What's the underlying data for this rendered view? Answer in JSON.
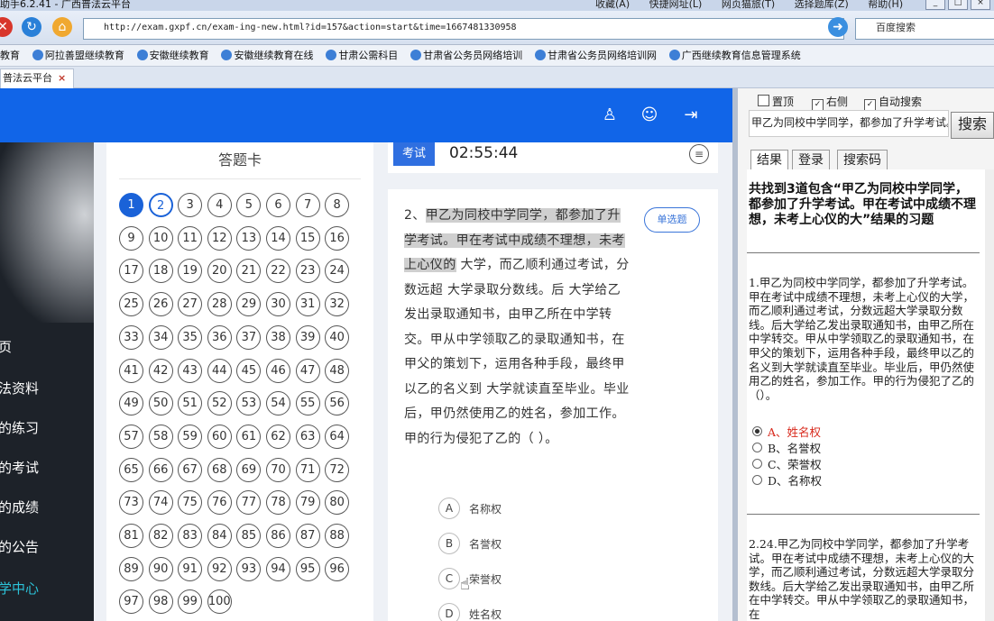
{
  "browser": {
    "title": "助手6.2.41  -  广西普法云平台",
    "menu": [
      "收藏(A)",
      "快捷网址(L)",
      "网页猫旅(T)",
      "选择题库(Z)",
      "帮助(H)"
    ],
    "url": "http://exam.gxpf.cn/exam-ing-new.html?id=157&action=start&time=1667481330958",
    "search_placeholder": "百度搜索",
    "favorites": [
      "教育",
      "阿拉善盟继续教育",
      "安徽继续教育",
      "安徽继续教育在线",
      "甘肃公需科目",
      "甘肃省公务员网络培训",
      "甘肃省公务员网络培训网",
      "广西继续教育信息管理系统"
    ],
    "tab_title": "普法云平台"
  },
  "sidebar": {
    "items": [
      "页",
      "法资料",
      "的练习",
      "的考试",
      "的成绩",
      "的公告",
      "学中心"
    ]
  },
  "answer_card": {
    "title": "答题卡",
    "current": 1,
    "next": 2,
    "numbers": [
      "1",
      "2",
      "3",
      "4",
      "5",
      "6",
      "7",
      "8",
      "9",
      "10",
      "11",
      "12",
      "13",
      "14",
      "15",
      "16",
      "17",
      "18",
      "19",
      "20",
      "21",
      "22",
      "23",
      "24",
      "25",
      "26",
      "27",
      "28",
      "29",
      "30",
      "31",
      "32",
      "33",
      "34",
      "35",
      "36",
      "37",
      "38",
      "39",
      "40",
      "41",
      "42",
      "43",
      "44",
      "45",
      "46",
      "47",
      "48",
      "49",
      "50",
      "51",
      "52",
      "53",
      "54",
      "55",
      "56",
      "57",
      "58",
      "59",
      "60",
      "61",
      "62",
      "63",
      "64",
      "65",
      "66",
      "67",
      "68",
      "69",
      "70",
      "71",
      "72",
      "73",
      "74",
      "75",
      "76",
      "77",
      "78",
      "79",
      "80",
      "81",
      "82",
      "83",
      "84",
      "85",
      "86",
      "87",
      "88",
      "89",
      "90",
      "91",
      "92",
      "93",
      "94",
      "95",
      "96",
      "97",
      "98",
      "99",
      "100"
    ]
  },
  "exam": {
    "badge": "考试",
    "timer": "02:55:44",
    "question_prefix": "2、",
    "question_highlight": "甲乙为同校中学同学，都参加了升学考试。甲在考试中成绩不理想，未考上心仪的",
    "question_rest": " 大学，而乙顺利通过考试，分数远超 大学录取分数线。后 大学给乙发出录取通知书，由甲乙所在中学转交。甲从中学领取乙的录取通知书，在甲父的策划下，运用各种手段，最终甲以乙的名义到 大学就读直至毕业。毕业后，甲仍然使用乙的姓名，参加工作。甲的行为侵犯了乙的（ ）。",
    "question_type": "单选题",
    "options": [
      {
        "key": "A",
        "text": "名称权"
      },
      {
        "key": "B",
        "text": "名誉权"
      },
      {
        "key": "C",
        "text": "荣誉权"
      },
      {
        "key": "D",
        "text": "姓名权"
      }
    ]
  },
  "plugin": {
    "checks": [
      {
        "label": "置顶",
        "checked": false
      },
      {
        "label": "右侧",
        "checked": true
      },
      {
        "label": "自动搜索",
        "checked": true
      }
    ],
    "keyword": "甲乙为同校中学同学，都参加了升学考试。",
    "search_button": "搜索",
    "tabs": [
      "结果",
      "登录",
      "搜索码"
    ],
    "summary": "共找到3道包含“甲乙为同校中学同学，都参加了升学考试。甲在考试中成绩不理想，未考上心仪的大”结果的习题",
    "result1": {
      "question": "1.甲乙为同校中学同学，都参加了升学考试。甲在考试中成绩不理想，未考上心仪的大学，而乙顺利通过考试，分数远超大学录取分数线。后大学给乙发出录取通知书，由甲乙所在中学转交。甲从中学领取乙的录取通知书，在甲父的策划下，运用各种手段，最终甲以乙的名义到大学就读直至毕业。毕业后，甲仍然使用乙的姓名，参加工作。甲的行为侵犯了乙的（）。",
      "options": [
        "A、姓名权",
        "B、名誉权",
        "C、荣誉权",
        "D、名称权"
      ],
      "selected": 0
    },
    "result2": {
      "question": "2.24.甲乙为同校中学同学，都参加了升学考试。甲在考试中成绩不理想，未考上心仪的大学，而乙顺利通过考试，分数远超大学录取分数线。后大学给乙发出录取通知书，由甲乙所在中学转交。甲从中学领取乙的录取通知书，在"
    }
  }
}
